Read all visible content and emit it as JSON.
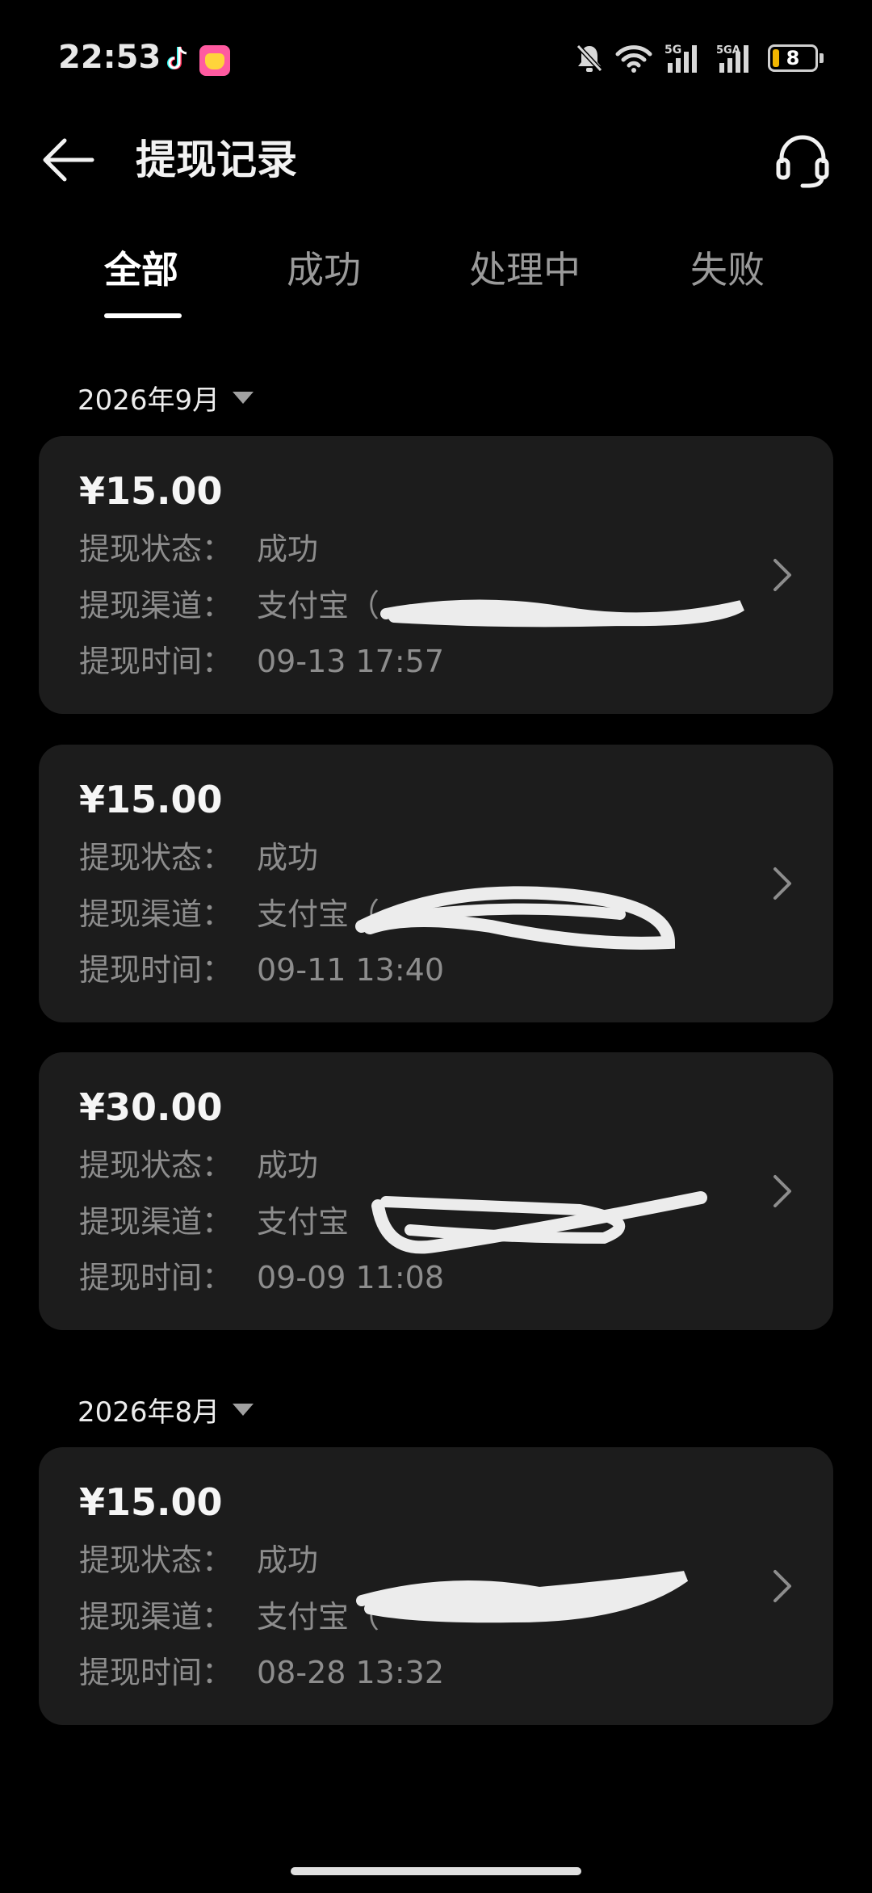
{
  "status_bar": {
    "time": "22:53",
    "icons": [
      "tiktok-icon",
      "app-icon",
      "mute-bell-icon",
      "wifi-icon",
      "signal-5g-icon",
      "signal-5ga-icon",
      "battery-icon"
    ],
    "signal_1_label": "5G",
    "signal_2_label": "5GA",
    "battery_level": "8"
  },
  "header": {
    "title": "提现记录",
    "back_icon": "arrow-left-icon",
    "support_icon": "headset-icon"
  },
  "tabs": [
    {
      "label": "全部",
      "active": true
    },
    {
      "label": "成功",
      "active": false
    },
    {
      "label": "处理中",
      "active": false
    },
    {
      "label": "失败",
      "active": false
    }
  ],
  "groups": [
    {
      "month": "2026年9月",
      "records": [
        {
          "amount": "¥15.00",
          "status_label": "提现状态：",
          "status": "成功",
          "channel_label": "提现渠道：",
          "channel": "支付宝（",
          "time_label": "提现时间：",
          "time": "09-13 17:57"
        },
        {
          "amount": "¥15.00",
          "status_label": "提现状态：",
          "status": "成功",
          "channel_label": "提现渠道：",
          "channel": "支付宝（",
          "time_label": "提现时间：",
          "time": "09-11 13:40"
        },
        {
          "amount": "¥30.00",
          "status_label": "提现状态：",
          "status": "成功",
          "channel_label": "提现渠道：",
          "channel": "支付宝",
          "time_label": "提现时间：",
          "time": "09-09 11:08"
        }
      ]
    },
    {
      "month": "2026年8月",
      "records": [
        {
          "amount": "¥15.00",
          "status_label": "提现状态：",
          "status": "成功",
          "channel_label": "提现渠道：",
          "channel": "支付宝（",
          "time_label": "提现时间：",
          "time": "08-28 13:32"
        }
      ]
    }
  ],
  "colors": {
    "background": "#000000",
    "card": "#1c1c1c",
    "label_gray": "#8d8d8d",
    "active_tab": "#ffffff",
    "inactive_tab": "#9a9a9a"
  }
}
